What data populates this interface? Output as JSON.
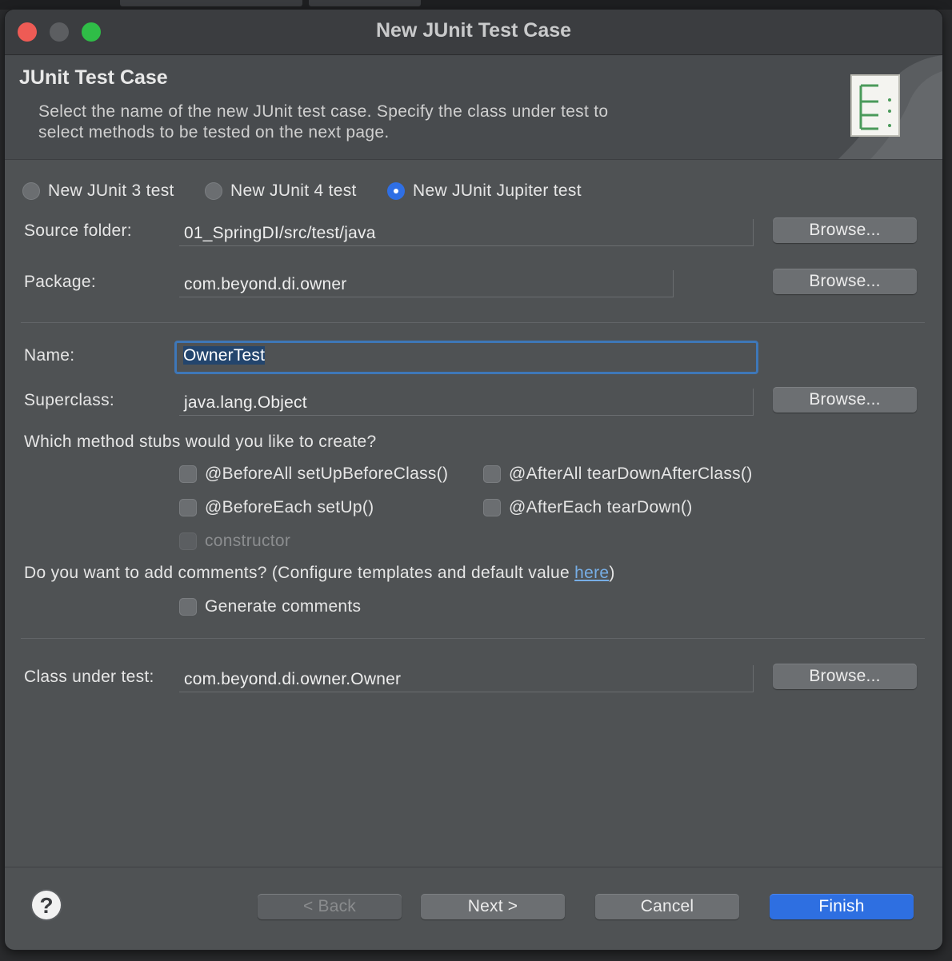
{
  "window": {
    "title": "New JUnit Test Case"
  },
  "banner": {
    "title": "JUnit Test Case",
    "description_line1": "Select the name of the new JUnit test case. Specify the class under test to",
    "description_line2": "select methods to be tested on the next page."
  },
  "test_type": {
    "options": [
      {
        "label": "New JUnit 3 test",
        "selected": false
      },
      {
        "label": "New JUnit 4 test",
        "selected": false
      },
      {
        "label": "New JUnit Jupiter test",
        "selected": true
      }
    ]
  },
  "source_folder": {
    "label": "Source folder:",
    "value": "01_SpringDI/src/test/java",
    "browse": "Browse..."
  },
  "package": {
    "label": "Package:",
    "value": "com.beyond.di.owner",
    "browse": "Browse..."
  },
  "name": {
    "label": "Name:",
    "value": "OwnerTest"
  },
  "superclass": {
    "label": "Superclass:",
    "value": "java.lang.Object",
    "browse": "Browse..."
  },
  "stubs": {
    "question": "Which method stubs would you like to create?",
    "items": [
      {
        "label": "@BeforeAll setUpBeforeClass()",
        "checked": false,
        "enabled": true
      },
      {
        "label": "@AfterAll tearDownAfterClass()",
        "checked": false,
        "enabled": true
      },
      {
        "label": "@BeforeEach setUp()",
        "checked": false,
        "enabled": true
      },
      {
        "label": "@AfterEach tearDown()",
        "checked": false,
        "enabled": true
      },
      {
        "label": "constructor",
        "checked": false,
        "enabled": false
      }
    ]
  },
  "comments": {
    "question_prefix": "Do you want to add comments? (Configure templates and default value ",
    "link": "here",
    "question_suffix": ")",
    "generate_label": "Generate comments"
  },
  "class_under_test": {
    "label": "Class under test:",
    "value": "com.beyond.di.owner.Owner",
    "browse": "Browse..."
  },
  "footer": {
    "help": "?",
    "back": "< Back",
    "next": "Next >",
    "cancel": "Cancel",
    "finish": "Finish"
  },
  "colors": {
    "accent": "#2e6fe1",
    "window_bg": "#4f5254",
    "link": "#77aee6",
    "close": "#ee5b55",
    "maximize": "#2fbd47"
  }
}
